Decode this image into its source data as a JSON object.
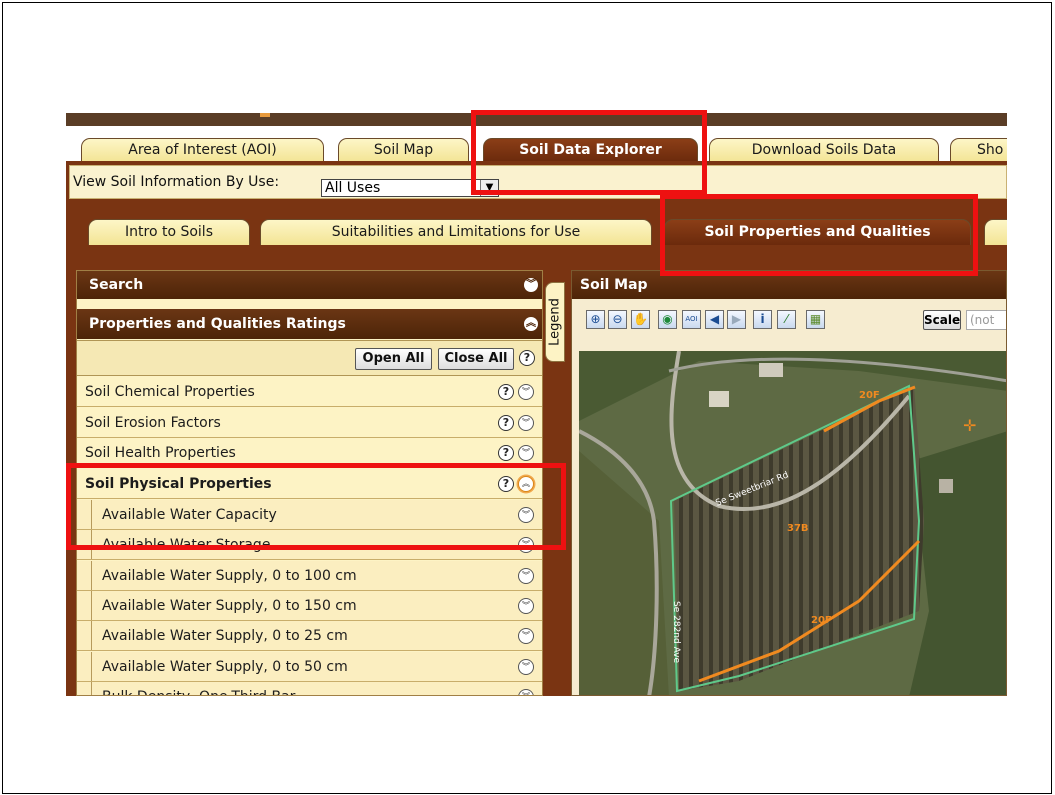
{
  "main_tabs": [
    {
      "label": "Area of Interest (AOI)"
    },
    {
      "label": "Soil Map"
    },
    {
      "label": "Soil Data Explorer",
      "active": true
    },
    {
      "label": "Download Soils Data"
    },
    {
      "label": "Sho"
    }
  ],
  "use_bar": {
    "label": "View Soil Information By Use:",
    "selected": "All Uses"
  },
  "sub_tabs": [
    {
      "label": "Intro to Soils"
    },
    {
      "label": "Suitabilities and Limitations for Use"
    },
    {
      "label": "Soil Properties and Qualities",
      "active": true
    }
  ],
  "left_panel": {
    "search_title": "Search",
    "ratings_title": "Properties and Qualities Ratings",
    "open_all": "Open All",
    "close_all": "Close All",
    "help_glyph": "?",
    "groups": [
      {
        "label": "Soil Chemical Properties"
      },
      {
        "label": "Soil Erosion Factors"
      },
      {
        "label": "Soil Health Properties"
      },
      {
        "label": "Soil Physical Properties",
        "expanded": true
      }
    ],
    "children": [
      {
        "label": "Available Water Capacity"
      },
      {
        "label": "Available Water Storage"
      },
      {
        "label": "Available Water Supply, 0 to 100 cm"
      },
      {
        "label": "Available Water Supply, 0 to 150 cm"
      },
      {
        "label": "Available Water Supply, 0 to 25 cm"
      },
      {
        "label": "Available Water Supply, 0 to 50 cm"
      },
      {
        "label": "Bulk Density, One-Third Bar"
      }
    ]
  },
  "legend_tab": "Legend",
  "map": {
    "title": "Soil Map",
    "scale_label": "Scale",
    "scale_value": "(not",
    "tools": [
      "zoom-in-icon",
      "zoom-out-icon",
      "pan-hand-icon",
      "globe-icon",
      "aoi-icon",
      "back-arrow-icon",
      "forward-arrow-icon",
      "info-icon",
      "measure-icon",
      "layers-icon"
    ],
    "map_labels": {
      "unit_20f_top": "20F",
      "unit_37b": "37B",
      "unit_20f_bottom": "20F",
      "road_1": "Se Sweetbriar Rd",
      "road_2": "Se 282nd Ave"
    }
  },
  "colors": {
    "tab_active": "#6b2a0c",
    "tab_inactive": "#fdf6c7",
    "panel_header": "#4d2408",
    "highlight": "#ee1111",
    "soil_line_orange": "#f08a20",
    "aoi_line_green": "#4fb27a"
  }
}
